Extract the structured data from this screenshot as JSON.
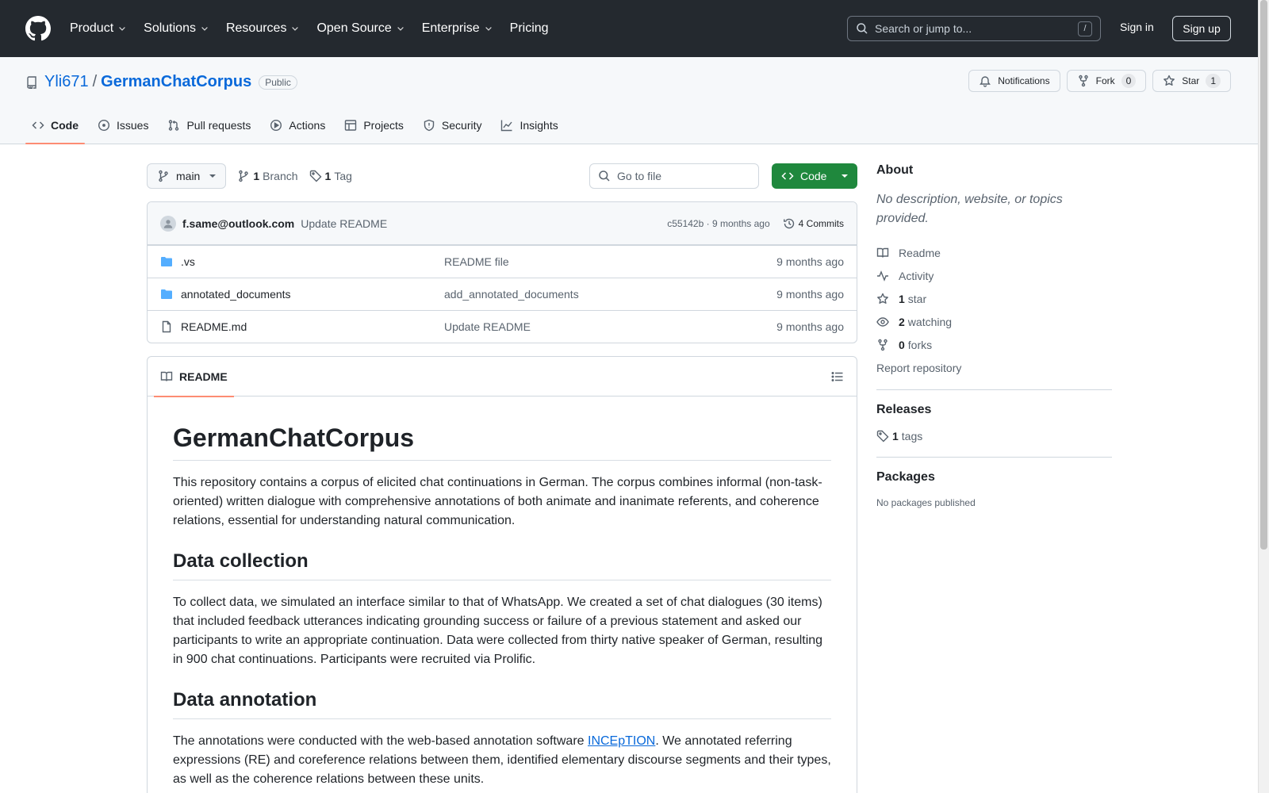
{
  "header": {
    "nav": [
      {
        "label": "Product",
        "dropdown": true
      },
      {
        "label": "Solutions",
        "dropdown": true
      },
      {
        "label": "Resources",
        "dropdown": true
      },
      {
        "label": "Open Source",
        "dropdown": true
      },
      {
        "label": "Enterprise",
        "dropdown": true
      },
      {
        "label": "Pricing",
        "dropdown": false
      }
    ],
    "search_placeholder": "Search or jump to...",
    "search_shortcut": "/",
    "sign_in": "Sign in",
    "sign_up": "Sign up"
  },
  "repo": {
    "owner": "Yli671",
    "separator": "/",
    "name": "GermanChatCorpus",
    "visibility": "Public",
    "notifications_label": "Notifications",
    "fork_label": "Fork",
    "fork_count": "0",
    "star_label": "Star",
    "star_count": "1",
    "tabs": [
      {
        "label": "Code",
        "icon": "code-icon",
        "active": true
      },
      {
        "label": "Issues",
        "icon": "issue-icon",
        "active": false
      },
      {
        "label": "Pull requests",
        "icon": "pull-request-icon",
        "active": false
      },
      {
        "label": "Actions",
        "icon": "play-icon",
        "active": false
      },
      {
        "label": "Projects",
        "icon": "table-icon",
        "active": false
      },
      {
        "label": "Security",
        "icon": "shield-icon",
        "active": false
      },
      {
        "label": "Insights",
        "icon": "graph-icon",
        "active": false
      }
    ]
  },
  "toolbar": {
    "branch": "main",
    "branch_count": "1",
    "branch_label": "Branch",
    "tag_count": "1",
    "tag_label": "Tag",
    "goto_placeholder": "Go to file",
    "code_label": "Code"
  },
  "commit": {
    "author": "f.same@outlook.com",
    "message": "Update README",
    "hash_time": "c55142b · 9 months ago",
    "commits_label": "4 Commits"
  },
  "files": [
    {
      "name": ".vs",
      "type": "folder",
      "message": "README file",
      "date": "9 months ago"
    },
    {
      "name": "annotated_documents",
      "type": "folder",
      "message": "add_annotated_documents",
      "date": "9 months ago"
    },
    {
      "name": "README.md",
      "type": "file",
      "message": "Update README",
      "date": "9 months ago"
    }
  ],
  "readme": {
    "tab_label": "README",
    "title": "GermanChatCorpus",
    "intro": "This repository contains a corpus of elicited chat continuations in German. The corpus combines informal (non-task-oriented) written dialogue with comprehensive annotations of both animate and inanimate referents, and coherence relations, essential for understanding natural communication.",
    "h_collection": "Data collection",
    "p_collection": "To collect data, we simulated an interface similar to that of WhatsApp. We created a set of chat dialogues (30 items) that included feedback utterances indicating grounding success or failure of a previous statement and asked our participants to write an appropriate continuation. Data were collected from thirty native speaker of German, resulting in 900 chat continuations. Participants were recruited via Prolific.",
    "h_annotation": "Data annotation",
    "p_annotation_before": "The annotations were conducted with the web-based annotation software ",
    "p_annotation_link": "INCEpTION",
    "p_annotation_after": ". We annotated referring expressions (RE) and coreference relations between them, identified elementary discourse segments and their types, as well as the coherence relations between these units."
  },
  "sidebar": {
    "about_title": "About",
    "about_desc": "No description, website, or topics provided.",
    "readme_label": "Readme",
    "activity_label": "Activity",
    "stars_count": "1",
    "stars_label": "star",
    "watching_count": "2",
    "watching_label": "watching",
    "forks_count": "0",
    "forks_label": "forks",
    "report_label": "Report repository",
    "releases_title": "Releases",
    "tags_count": "1",
    "tags_label": "tags",
    "packages_title": "Packages",
    "packages_note": "No packages published"
  },
  "colors": {
    "header_bg": "#24292f",
    "link": "#0969da",
    "primary_button": "#1f883d",
    "active_tab_underline": "#fd8c73",
    "folder": "#54aeff"
  }
}
